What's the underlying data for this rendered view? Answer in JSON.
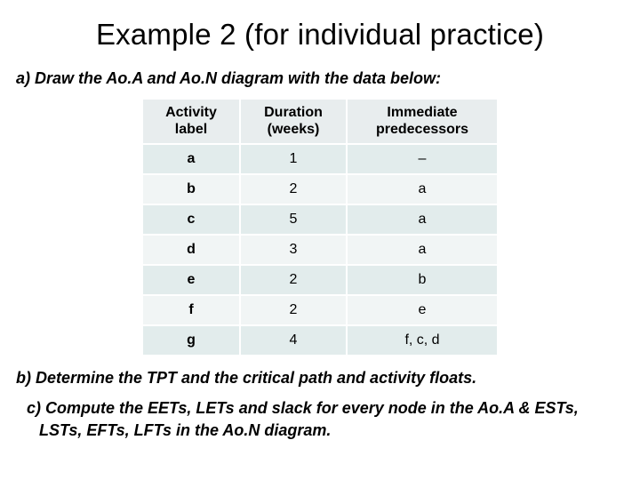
{
  "title": "Example 2 (for individual practice)",
  "prompt_a": "a) Draw the Ao.A and Ao.N diagram with the data below:",
  "prompt_b": "b) Determine the TPT and the critical path and activity floats.",
  "prompt_c": "c) Compute the EETs, LETs and slack for every node in the Ao.A & ESTs, LSTs, EFTs, LFTs in the Ao.N diagram.",
  "table": {
    "headers": {
      "activity": "Activity label",
      "duration": "Duration (weeks)",
      "predecessors": "Immediate predecessors"
    },
    "rows": [
      {
        "activity": "a",
        "duration": "1",
        "predecessors": "–"
      },
      {
        "activity": "b",
        "duration": "2",
        "predecessors": "a"
      },
      {
        "activity": "c",
        "duration": "5",
        "predecessors": "a"
      },
      {
        "activity": "d",
        "duration": "3",
        "predecessors": "a"
      },
      {
        "activity": "e",
        "duration": "2",
        "predecessors": "b"
      },
      {
        "activity": "f",
        "duration": "2",
        "predecessors": "e"
      },
      {
        "activity": "g",
        "duration": "4",
        "predecessors": "f, c, d"
      }
    ]
  }
}
